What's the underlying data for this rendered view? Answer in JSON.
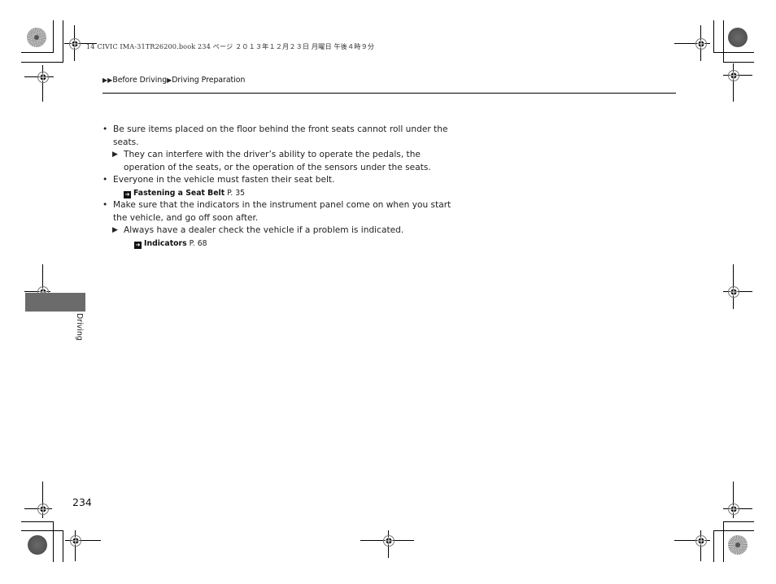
{
  "print_header": {
    "file_info": "14 CIVIC IMA-31TR26200.book  234 ページ  ２０１３年１２月２３日  月曜日  午後４時９分"
  },
  "breadcrumb": {
    "prefix_icon": "double-triangle-right",
    "items": [
      "Before Driving",
      "Driving Preparation"
    ],
    "separator_icon": "triangle-right"
  },
  "content": {
    "bullets": [
      {
        "text": "Be sure items placed on the floor behind the front seats cannot roll under the seats.",
        "note": "They can interfere with the driver’s ability to operate the pedals, the operation of the seats, or the operation of the sensors under the seats."
      },
      {
        "text": "Everyone in the vehicle must fasten their seat belt.",
        "ref": {
          "title": "Fastening a Seat Belt",
          "page": "P. 35"
        }
      },
      {
        "text": "Make sure that the indicators in the instrument panel come on when you start the vehicle, and go off soon after.",
        "note": "Always have a dealer check the vehicle if a problem is indicated.",
        "ref": {
          "title": "Indicators",
          "page": "P. 68"
        }
      }
    ]
  },
  "side_tab": {
    "label": "Driving",
    "color": "#6b6b6b"
  },
  "page_number": "234"
}
